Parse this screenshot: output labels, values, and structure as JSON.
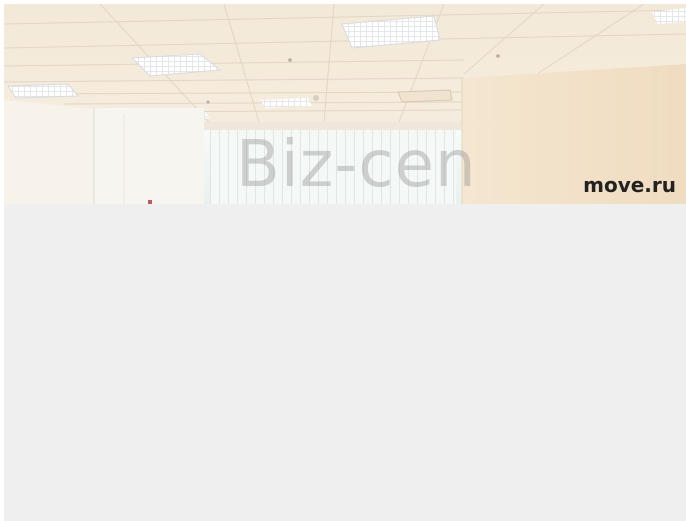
{
  "listing_photo": {
    "watermark_text": "Biz-cen",
    "brand": {
      "name": "move.ru",
      "icon": "house-logo-icon",
      "accent_color": "#f5a623"
    }
  },
  "colors": {
    "placeholder_background": "#efefef",
    "page_background": "#ffffff"
  }
}
